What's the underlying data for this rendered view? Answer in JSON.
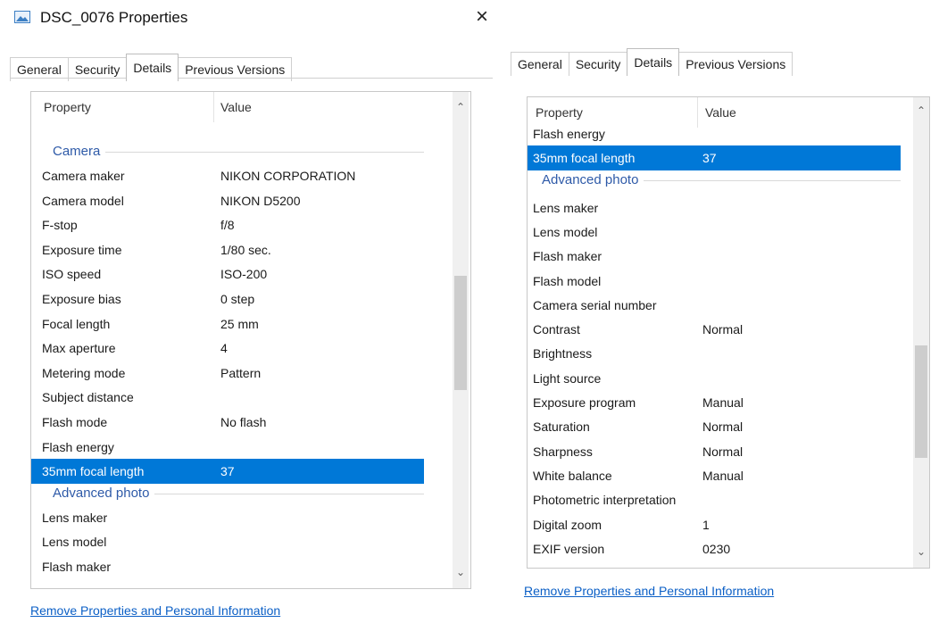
{
  "window": {
    "title": "DSC_0076 Properties",
    "close_glyph": "×"
  },
  "tabs": [
    "General",
    "Security",
    "Details",
    "Previous Versions"
  ],
  "columns": {
    "property": "Property",
    "value": "Value"
  },
  "left_rows": [
    {
      "kind": "group",
      "label": "Camera"
    },
    {
      "kind": "row",
      "property": "Camera maker",
      "value": "NIKON CORPORATION"
    },
    {
      "kind": "row",
      "property": "Camera model",
      "value": "NIKON D5200"
    },
    {
      "kind": "row",
      "property": "F-stop",
      "value": "f/8"
    },
    {
      "kind": "row",
      "property": "Exposure time",
      "value": "1/80 sec."
    },
    {
      "kind": "row",
      "property": "ISO speed",
      "value": "ISO-200"
    },
    {
      "kind": "row",
      "property": "Exposure bias",
      "value": "0 step"
    },
    {
      "kind": "row",
      "property": "Focal length",
      "value": "25 mm"
    },
    {
      "kind": "row",
      "property": "Max aperture",
      "value": "4"
    },
    {
      "kind": "row",
      "property": "Metering mode",
      "value": "Pattern"
    },
    {
      "kind": "row",
      "property": "Subject distance",
      "value": ""
    },
    {
      "kind": "row",
      "property": "Flash mode",
      "value": "No flash"
    },
    {
      "kind": "row",
      "property": "Flash energy",
      "value": ""
    },
    {
      "kind": "row",
      "property": "35mm focal length",
      "value": "37",
      "selected": true
    },
    {
      "kind": "group",
      "label": "Advanced photo"
    },
    {
      "kind": "row",
      "property": "Lens maker",
      "value": ""
    },
    {
      "kind": "row",
      "property": "Lens model",
      "value": ""
    },
    {
      "kind": "row",
      "property": "Flash maker",
      "value": ""
    }
  ],
  "right_rows": [
    {
      "kind": "row",
      "property": "Flash energy",
      "value": ""
    },
    {
      "kind": "row",
      "property": "35mm focal length",
      "value": "37",
      "selected": true
    },
    {
      "kind": "group",
      "label": "Advanced photo"
    },
    {
      "kind": "row",
      "property": "Lens maker",
      "value": ""
    },
    {
      "kind": "row",
      "property": "Lens model",
      "value": ""
    },
    {
      "kind": "row",
      "property": "Flash maker",
      "value": ""
    },
    {
      "kind": "row",
      "property": "Flash model",
      "value": ""
    },
    {
      "kind": "row",
      "property": "Camera serial number",
      "value": ""
    },
    {
      "kind": "row",
      "property": "Contrast",
      "value": "Normal"
    },
    {
      "kind": "row",
      "property": "Brightness",
      "value": ""
    },
    {
      "kind": "row",
      "property": "Light source",
      "value": ""
    },
    {
      "kind": "row",
      "property": "Exposure program",
      "value": "Manual"
    },
    {
      "kind": "row",
      "property": "Saturation",
      "value": "Normal"
    },
    {
      "kind": "row",
      "property": "Sharpness",
      "value": "Normal"
    },
    {
      "kind": "row",
      "property": "White balance",
      "value": "Manual"
    },
    {
      "kind": "row",
      "property": "Photometric interpretation",
      "value": ""
    },
    {
      "kind": "row",
      "property": "Digital zoom",
      "value": "1"
    },
    {
      "kind": "row",
      "property": "EXIF version",
      "value": "0230"
    }
  ],
  "link_text": "Remove Properties and Personal Information",
  "icons": {
    "scroll_up": "up-arrow-icon",
    "scroll_down": "down-arrow-icon",
    "app": "image-file-icon",
    "close": "close-icon"
  },
  "colors": {
    "selection": "#0078d7",
    "group_label": "#2e5aa8",
    "link": "#0b5fc6"
  }
}
